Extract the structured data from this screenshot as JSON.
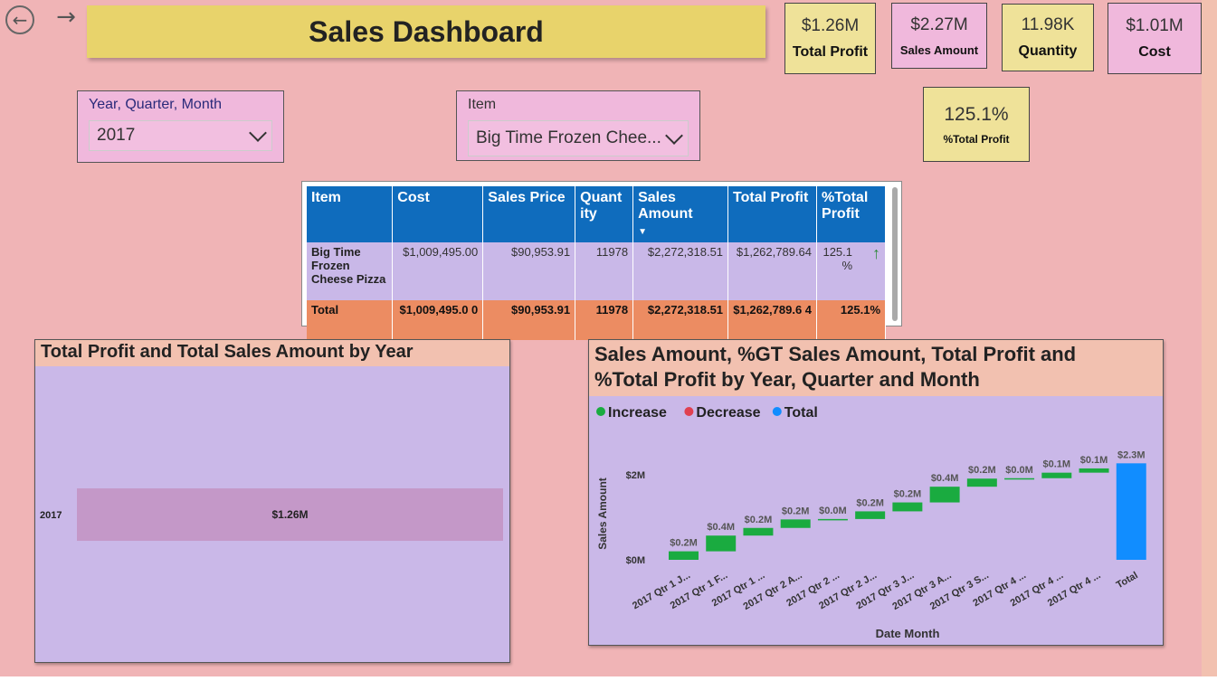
{
  "nav": {
    "back_icon": "arrow-left-circle-icon",
    "forward_icon": "arrow-right-icon"
  },
  "dashboard": {
    "title": "Sales Dashboard"
  },
  "kpis": [
    {
      "value": "$1.26M",
      "label": "Total Profit"
    },
    {
      "value": "$2.27M",
      "label": "Sales Amount"
    },
    {
      "value": "11.98K",
      "label": "Quantity"
    },
    {
      "value": "$1.01M",
      "label": "Cost"
    },
    {
      "value": "125.1%",
      "label": "%Total Profit"
    }
  ],
  "slicers": {
    "date": {
      "label": "Year, Quarter, Month",
      "value": "2017"
    },
    "item": {
      "label": "Item",
      "value": "Big Time Frozen Chee..."
    }
  },
  "table": {
    "columns": [
      "Item",
      "Cost",
      "Sales Price",
      "Quant ity",
      "Sales Amount",
      "Total Profit",
      "%Total Profit"
    ],
    "rows": [
      [
        "Big Time Frozen Cheese Pizza",
        "$1,009,495.00",
        "$90,953.91",
        "11978",
        "$2,272,318.51",
        "$1,262,789.64",
        "125.1 %"
      ]
    ],
    "total": [
      "Total",
      "$1,009,495.0 0",
      "$90,953.91",
      "11978",
      "$2,272,318.51",
      "$1,262,789.6 4",
      "125.1%"
    ],
    "sort_icon": "sort-desc-icon",
    "trend_icon": "arrow-up-icon"
  },
  "bar_panel": {
    "title": "Total Profit and Total Sales Amount by Year"
  },
  "waterfall_panel": {
    "title_line1": "Sales Amount, %GT Sales Amount, Total Profit and",
    "title_line2": "%Total Profit by Year, Quarter and Month"
  },
  "chart_data": [
    {
      "type": "bar",
      "title": "Total Profit and Total Sales Amount by Year",
      "categories": [
        "2017"
      ],
      "values": [
        1.26
      ],
      "data_labels": [
        "$1.26M"
      ],
      "orientation": "horizontal",
      "color": "#c498c8"
    },
    {
      "type": "waterfall",
      "xlabel": "Date Month",
      "ylabel": "Sales Amount",
      "ytick_labels": [
        "$0M",
        "$2M"
      ],
      "yticks": [
        0,
        2
      ],
      "ylim": [
        -0.05,
        2.55
      ],
      "legend": [
        {
          "name": "Increase",
          "color": "#1aab40"
        },
        {
          "name": "Decrease",
          "color": "#e04050"
        },
        {
          "name": "Total",
          "color": "#118dff"
        }
      ],
      "legend_position": "top-left",
      "categories": [
        "2017 Qtr 1 J...",
        "2017 Qtr 1 F...",
        "2017 Qtr 1 ...",
        "2017 Qtr 2 A...",
        "2017 Qtr 2 ...",
        "2017 Qtr 2 J...",
        "2017 Qtr 3 J...",
        "2017 Qtr 3 A...",
        "2017 Qtr 3 S...",
        "2017 Qtr 4 ...",
        "2017 Qtr 4 ...",
        "2017 Qtr 4 ...",
        "Total"
      ],
      "values": [
        0.2,
        0.37,
        0.18,
        0.2,
        0.01,
        0.18,
        0.21,
        0.37,
        0.19,
        0.01,
        0.13,
        0.1,
        2.27
      ],
      "data_labels": [
        "$0.2M",
        "$0.4M",
        "$0.2M",
        "$0.2M",
        "$0.0M",
        "$0.2M",
        "$0.2M",
        "$0.4M",
        "$0.2M",
        "$0.0M",
        "$0.1M",
        "$0.1M",
        "$2.3M"
      ],
      "kinds": [
        "increase",
        "increase",
        "increase",
        "increase",
        "increase",
        "increase",
        "increase",
        "increase",
        "increase",
        "increase",
        "increase",
        "increase",
        "total"
      ]
    }
  ]
}
